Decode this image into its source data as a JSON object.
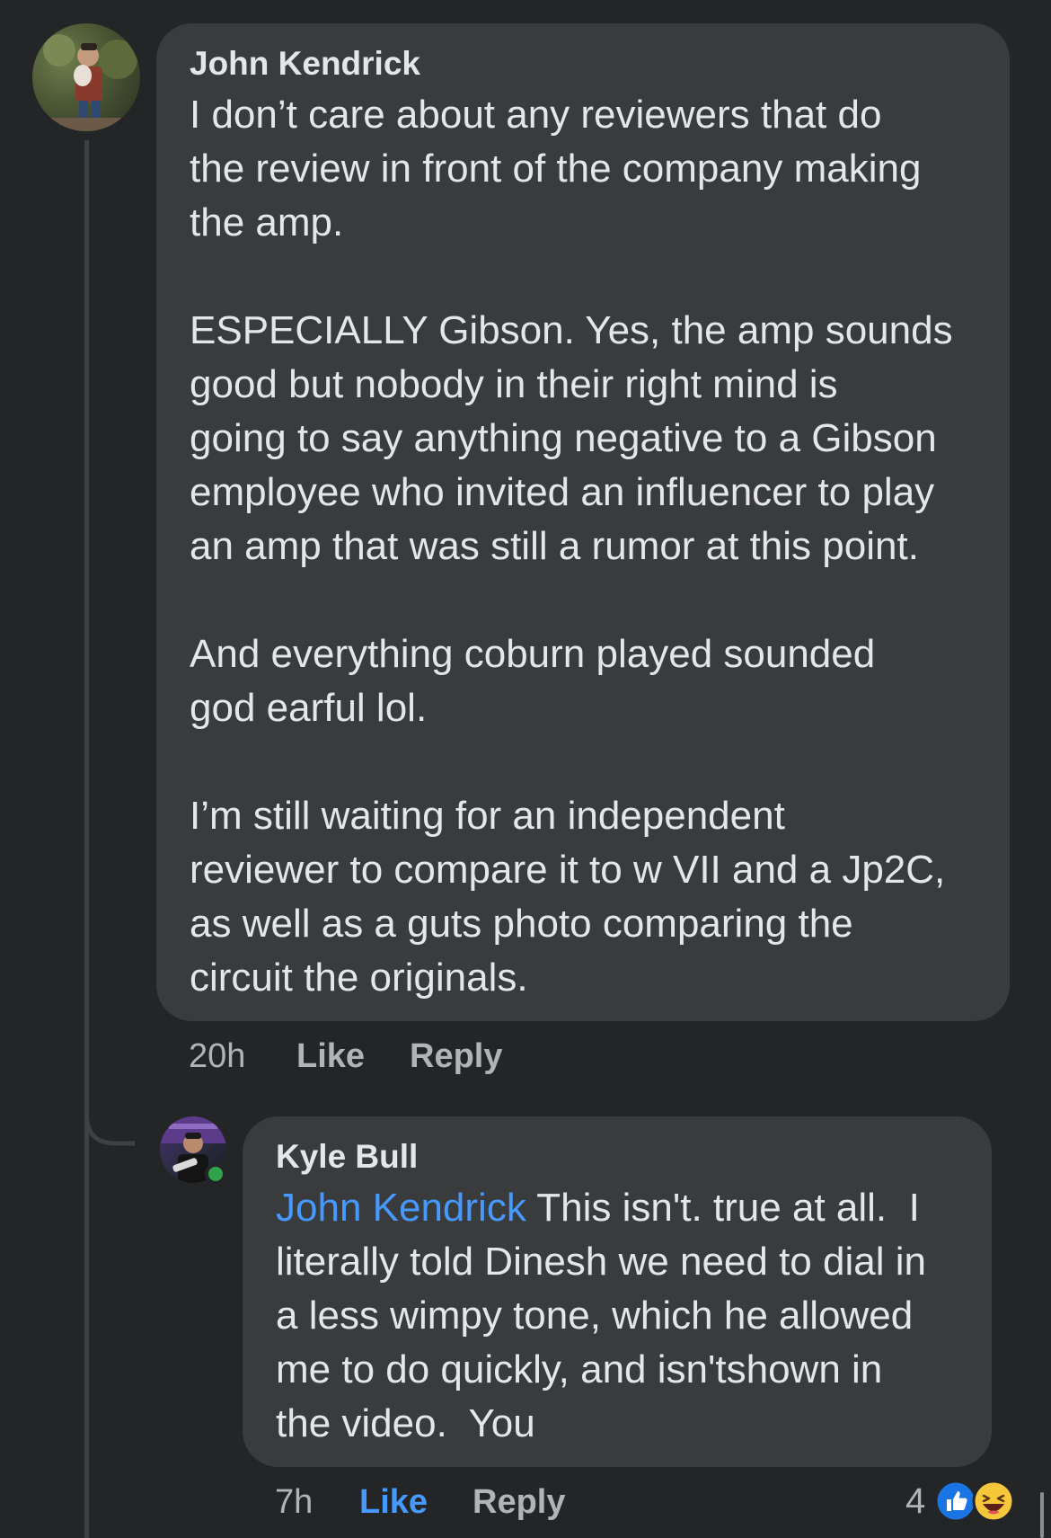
{
  "comment": {
    "author": "John Kendrick",
    "text": "I don’t care about any reviewers that do\nthe review in front of the company making\nthe amp.\n\nESPECIALLY Gibson. Yes, the amp sounds\ngood but nobody in their right mind is\ngoing to say anything negative to a Gibson\nemployee who invited an influencer to play\nan amp that was still a rumor at this point.\n\nAnd everything coburn played sounded\ngod earful lol.\n\nI’m still waiting for an independent\nreviewer to compare it to w VII and a Jp2C,\nas well as a guts photo comparing the\ncircuit the originals.",
    "time": "20h",
    "like_label": "Like",
    "reply_label": "Reply"
  },
  "reply": {
    "author": "Kyle Bull",
    "mention": "John Kendrick",
    "text": " This isn't. true at all.  I\nliterally told Dinesh we need to dial in\na less wimpy tone, which he allowed\nme to do quickly, and isn'tshown in\nthe video.  You",
    "time": "7h",
    "like_label": "Like",
    "reply_label": "Reply",
    "liked": true,
    "reaction_count": "4",
    "reactions": [
      "like-icon",
      "haha-icon"
    ],
    "online": true
  },
  "colors": {
    "background": "#242526",
    "bubble": "#3a3b3c",
    "accent": "#4599ff",
    "online": "#31a24c"
  }
}
